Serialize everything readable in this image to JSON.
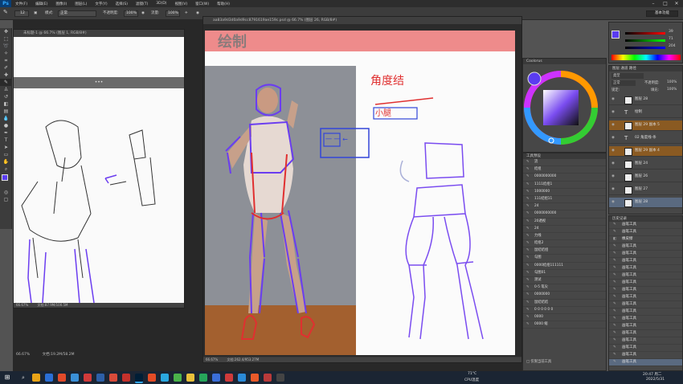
{
  "app": {
    "logo": "Ps"
  },
  "menu": [
    "文件(F)",
    "编辑(E)",
    "图像(I)",
    "图层(L)",
    "文字(Y)",
    "选择(S)",
    "滤镜(T)",
    "3D(D)",
    "视图(V)",
    "窗口(W)",
    "帮助(H)"
  ],
  "options": {
    "mode_label": "模式:",
    "mode_value": "正常",
    "opacity_label": "不透明度:",
    "opacity_value": "100%",
    "flow_label": "流量:",
    "flow_value": "100%",
    "brush_size": "12",
    "workspace": "基本功能"
  },
  "doc_left": {
    "title": "未标题-1 @ 66.7% (图层 1, RGB/8#)",
    "zoom": "66.67%",
    "status": "文档:87.9M/100.5M",
    "top_strip": "•••"
  },
  "doc_main": {
    "title": "aa83a9d3d0a9d9cc8791619ae159c.psd @ 66.7% (图层 26, RGB/8#)",
    "heading": "绘制",
    "zoom": "66.67%",
    "status": "文档:19.2M/58.2M",
    "annotation1": "角度结",
    "annotation2": "小腿",
    "box_text": "一 一 ←"
  },
  "right_status": {
    "zoom": "66.67%",
    "status": "文档:262.4/953.27M"
  },
  "color_panel": {
    "tab": "Coolorus",
    "r": "39",
    "g": "71",
    "b": "204",
    "fg": "#5a3cf0",
    "bg": "#ffffff"
  },
  "layers_panel": {
    "tabs": "图层 通道 路径",
    "kind": "类型",
    "blend": "正常",
    "opacity_label": "不透明度:",
    "opacity": "100%",
    "lock_label": "锁定:",
    "fill_label": "填充:",
    "fill": "100%",
    "layers": [
      "图层 28",
      "绘制",
      "图层 29 副本 5",
      "02 角度线-条",
      "图层 29 副本 4",
      "图层 24",
      "图层 26",
      "图层 27",
      "图层 28"
    ]
  },
  "tool_presets": {
    "tab": "工具预设",
    "items": [
      "流",
      "结组",
      "0000000000",
      "1111结组1",
      "1000000",
      "111结组11",
      "24",
      "0000000000",
      "20透视",
      "24",
      "力线",
      "结组2",
      "鼠结结组",
      "勾图",
      "0000结组111111",
      "勾图01",
      "测试",
      "0-5 笔尖",
      "0000000",
      "鼠结结结",
      "0 0 0 0 0 0",
      "0000",
      "0000 缩"
    ],
    "footer": "□ 仅限当前工具"
  },
  "history_panel": {
    "tab": "历史记录",
    "items": [
      "画笔工具",
      "画笔工具",
      "橡皮擦",
      "画笔工具",
      "画笔工具",
      "画笔工具",
      "画笔工具",
      "画笔工具",
      "画笔工具",
      "画笔工具",
      "画笔工具",
      "画笔工具",
      "画笔工具",
      "画笔工具",
      "画笔工具",
      "画笔工具",
      "画笔工具",
      "画笔工具",
      "画笔工具",
      "画笔工具"
    ]
  },
  "taskbar": {
    "temp": "71°C",
    "cpu": "CPU温度",
    "time": "20:47 周二",
    "date": "2022/5/31"
  }
}
